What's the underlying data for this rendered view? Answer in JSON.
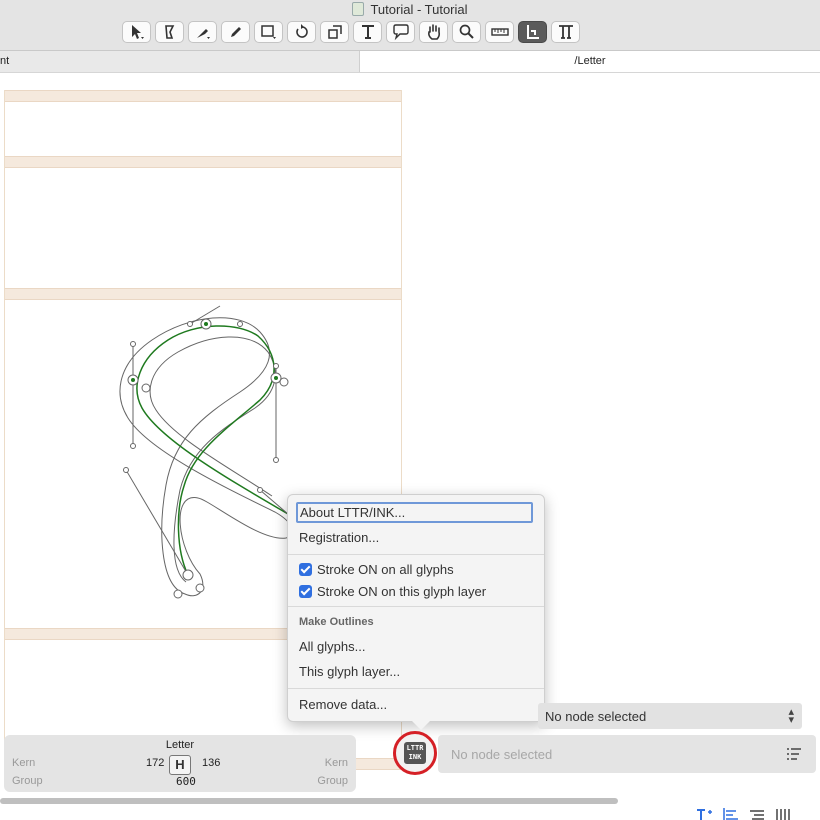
{
  "window": {
    "title": "Tutorial - Tutorial"
  },
  "toolbar": {
    "tools": [
      {
        "name": "select-tool-icon"
      },
      {
        "name": "draw-tool-icon"
      },
      {
        "name": "pen-tool-icon"
      },
      {
        "name": "pencil-tool-icon"
      },
      {
        "name": "rectangle-tool-icon"
      },
      {
        "name": "rotate-tool-icon"
      },
      {
        "name": "scale-tool-icon"
      },
      {
        "name": "text-tool-icon"
      },
      {
        "name": "annotation-tool-icon"
      },
      {
        "name": "hand-tool-icon"
      },
      {
        "name": "zoom-tool-icon"
      },
      {
        "name": "measure-tool-icon"
      },
      {
        "name": "metrics-tool-icon",
        "active": true
      },
      {
        "name": "type-tool-icon"
      }
    ]
  },
  "tabs": {
    "left": "nt",
    "right": "/Letter"
  },
  "context_menu": {
    "about": "About LTTR/INK...",
    "registration": "Registration...",
    "stroke_all": "Stroke ON on all glyphs",
    "stroke_layer": "Stroke ON on this glyph layer",
    "make_outlines_heading": "Make Outlines",
    "all_glyphs": "All glyphs...",
    "this_glyph_layer": "This glyph layer...",
    "remove_data": "Remove data..."
  },
  "node_select": {
    "value": "No node selected"
  },
  "inspector": {
    "placeholder": "No node selected"
  },
  "plugin": {
    "badge_line1": "LTTR",
    "badge_line2": "INK"
  },
  "kern_panel": {
    "glyph_name": "Letter",
    "left_kern_label": "Kern",
    "right_kern_label": "Kern",
    "left_group_label": "Group",
    "right_group_label": "Group",
    "left_sidebearing": "172",
    "right_sidebearing": "136",
    "width": "600",
    "glyph_preview": "H"
  },
  "colors": {
    "accent": "#2f6fe0",
    "highlight_ring": "#d52026",
    "path_green": "#1f7a1f"
  }
}
